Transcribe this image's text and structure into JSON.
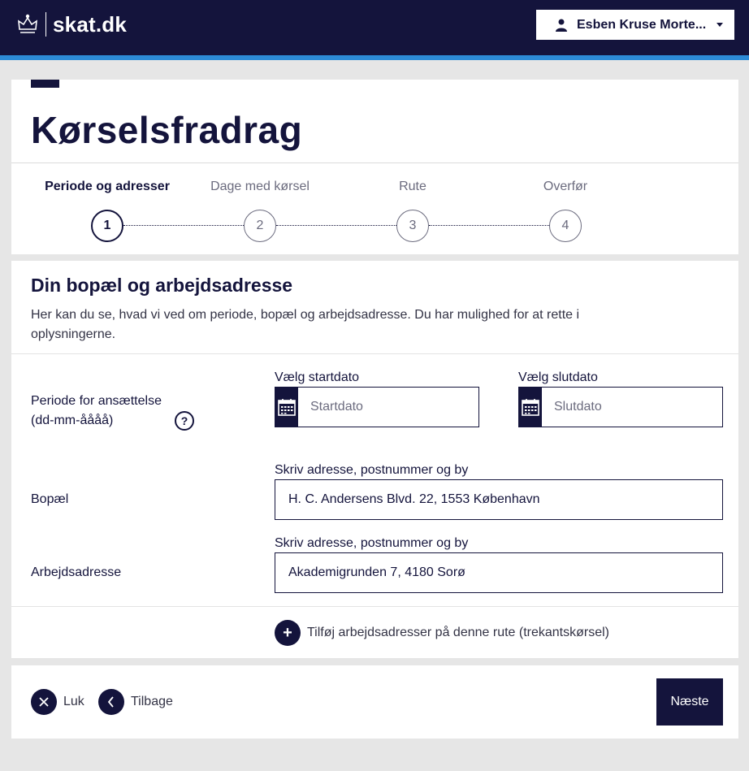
{
  "header": {
    "brand": "skat.dk",
    "user_name": "Esben Kruse Morte..."
  },
  "page": {
    "title": "Kørselsfradrag"
  },
  "stepper": {
    "steps": [
      {
        "label": "Periode og adresser",
        "number": "1",
        "active": true
      },
      {
        "label": "Dage med kørsel",
        "number": "2",
        "active": false
      },
      {
        "label": "Rute",
        "number": "3",
        "active": false
      },
      {
        "label": "Overfør",
        "number": "4",
        "active": false
      }
    ]
  },
  "section": {
    "title": "Din bopæl og arbejdsadresse",
    "description": "Her kan du se, hvad vi ved om periode, bopæl og arbejdsadresse. Du har mulighed for at rette i oplysningerne."
  },
  "period": {
    "label_line1": "Periode for ansættelse",
    "label_line2": "(dd-mm-åååå)",
    "help_symbol": "?",
    "start_label": "Vælg startdato",
    "start_placeholder": "Startdato",
    "end_label": "Vælg slutdato",
    "end_placeholder": "Slutdato"
  },
  "residence": {
    "label": "Bopæl",
    "input_label": "Skriv adresse, postnummer og by",
    "value": "H. C. Andersens Blvd. 22, 1553 København"
  },
  "work": {
    "label": "Arbejdsadresse",
    "input_label": "Skriv adresse, postnummer og by",
    "value": "Akademigrunden 7, 4180 Sorø"
  },
  "add_work": {
    "label": "Tilføj arbejdsadresser på denne rute (trekantskørsel)"
  },
  "footer": {
    "close_label": "Luk",
    "back_label": "Tilbage",
    "next_label": "Næste"
  },
  "colors": {
    "navy": "#14143c",
    "accent_blue": "#2d8bd6"
  }
}
